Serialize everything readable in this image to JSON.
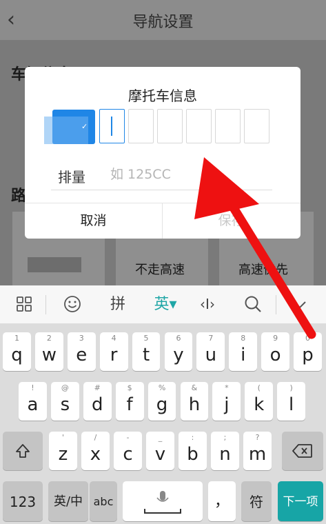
{
  "page": {
    "title": "导航设置",
    "section_vehicle": "车辆信息",
    "section_route": "路",
    "route_options": [
      "不走高速",
      "高速优先"
    ]
  },
  "dialog": {
    "title": "摩托车信息",
    "displacement_label": "排量",
    "displacement_placeholder": "如 125CC",
    "cancel_label": "取消",
    "save_label": "保存"
  },
  "keyboard": {
    "toolbar": {
      "apps_icon": "grid-icon",
      "emoji_icon": "smiley-icon",
      "pinyin_label": "拼",
      "english_label": "英▾",
      "cursor_label": "‹I›",
      "search_icon": "search-icon",
      "collapse_icon": "chevron-down-icon"
    },
    "row1": [
      {
        "k": "q",
        "s": "1"
      },
      {
        "k": "w",
        "s": "2"
      },
      {
        "k": "e",
        "s": "3"
      },
      {
        "k": "r",
        "s": "4"
      },
      {
        "k": "t",
        "s": "5"
      },
      {
        "k": "y",
        "s": "6"
      },
      {
        "k": "u",
        "s": "7"
      },
      {
        "k": "i",
        "s": "8"
      },
      {
        "k": "o",
        "s": "9"
      },
      {
        "k": "p",
        "s": "0"
      }
    ],
    "row2": [
      {
        "k": "a",
        "s": "!"
      },
      {
        "k": "s",
        "s": "@"
      },
      {
        "k": "d",
        "s": "#"
      },
      {
        "k": "f",
        "s": "$"
      },
      {
        "k": "g",
        "s": "%"
      },
      {
        "k": "h",
        "s": "&"
      },
      {
        "k": "j",
        "s": "*"
      },
      {
        "k": "k",
        "s": "("
      },
      {
        "k": "l",
        "s": ")"
      }
    ],
    "row3": [
      {
        "k": "z",
        "s": "'"
      },
      {
        "k": "x",
        "s": "/"
      },
      {
        "k": "c",
        "s": "-"
      },
      {
        "k": "v",
        "s": "_"
      },
      {
        "k": "b",
        "s": ":"
      },
      {
        "k": "n",
        "s": ";"
      },
      {
        "k": "m",
        "s": "?"
      }
    ],
    "bottom": {
      "num_label": "123",
      "lang_label": "英/中",
      "abc_label": "abc",
      "comma_label": "，",
      "symbol_label": "符",
      "next_label": "下一项"
    },
    "accent_color": "#17a5a6"
  }
}
